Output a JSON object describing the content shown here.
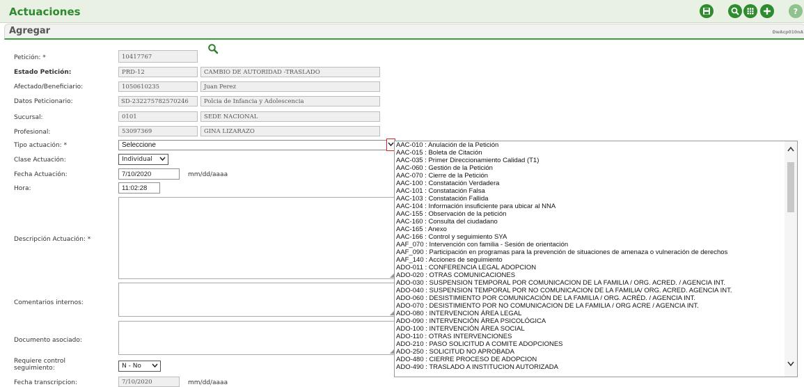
{
  "header": {
    "title": "Actuaciones"
  },
  "toolbar": {
    "icons": [
      "save-icon",
      "search-icon",
      "grid-icon",
      "add-icon",
      "help-icon"
    ]
  },
  "form": {
    "title": "Agregar",
    "program_code": "DwAcp010nA",
    "peticion": {
      "label": "Petición: *",
      "value": "10417767"
    },
    "estado": {
      "label": "Estado Petición:",
      "code": "PRD-12",
      "desc": "CAMBIO DE AUTORIDAD -TRASLADO"
    },
    "afectado": {
      "label": "Afectado/Beneficiario:",
      "code": "1050610235",
      "desc": "Juan Perez"
    },
    "peticionario": {
      "label": "Datos Peticionario:",
      "code": "SD-232275782570246",
      "desc": "Polcia de Infancia y Adolescencia"
    },
    "sucursal": {
      "label": "Sucursal:",
      "code": "0101",
      "desc": "SEDE NACIONAL"
    },
    "profesional": {
      "label": "Profesional:",
      "code": "53097369",
      "desc": "GINA LIZARAZO"
    },
    "tipo": {
      "label": "Tipo actuación: *",
      "value": "Seleccione"
    },
    "clase": {
      "label": "Clase Actuación:",
      "value": "Individual"
    },
    "fecha": {
      "label": "Fecha Actuación:",
      "value": "7/10/2020",
      "hint": "mm/dd/aaaa"
    },
    "hora": {
      "label": "Hora:",
      "value": "11:02:28"
    },
    "descripcion": {
      "label": "Descripción Actuación: *"
    },
    "comentarios": {
      "label": "Comentarios internos:"
    },
    "documento": {
      "label": "Documento asociado:"
    },
    "requiere": {
      "label_line1": "Requiere control",
      "label_line2": "seguimiento:",
      "value": "N - No"
    },
    "transcripcion": {
      "label": "Fecha transcripcion:",
      "value": "7/10/2020",
      "hint": "mm/dd/aaaa"
    }
  },
  "dropdown_options": [
    "AAC-010 : Anulación de la Petición",
    "AAC-015 : Boleta de Citación",
    "AAC-035 : Primer Direccionamiento Calidad (T1)",
    "AAC-060 : Gestión de la Petición",
    "AAC-070 : Cierre de la Petición",
    "AAC-100 : Constatación Verdadera",
    "AAC-101 : Constatación Falsa",
    "AAC-103 : Constatación Fallida",
    "AAC-104 : Información insuficiente para ubicar al NNA",
    "AAC-155 : Observación de la petición",
    "AAC-160 : Consulta del ciudadano",
    "AAC-165 : Anexo",
    "AAC-166 : Control y seguimiento SYA",
    "AAF_070 : Intervención con familia - Sesión de orientación",
    "AAF_090 : Participación en programas para la prevención de situaciones de amenaza o vulneración de derechos",
    "AAF_140 : Acciones de seguimiento",
    "ADO-011 : CONFERENCIA LEGAL ADOPCION",
    "ADO-020 : OTRAS COMUNICACIONES",
    "ADO-030 : SUSPENSION TEMPORAL POR COMUNICACION DE LA FAMILIA / ORG. ACRED. / AGENCIA INT.",
    "ADO-040 : SUSPENSION TEMPORAL POR NO COMUNICACION DE LA FAMILIA/ ORG. ACRED. AGENCIA INT.",
    "ADO-060 : DESISTIMIENTO POR COMUNICACIÓN DE LA FAMILIA / ORG. ACRÉD. / AGENCIA INT.",
    "ADO-070 : DESISTIMIENTO POR NO COMUNICACION DE LA FAMILIA / ORG ACRE / AGENCIA INT.",
    "ADO-080 : INTERVENCION ÁREA LEGAL",
    "ADO-090 : INTERVENCIÓN ÁREA PSICOLÓGICA",
    "ADO-100 : INTERVENCIÓN ÁREA SOCIAL",
    "ADO-110 : OTRAS INTERVENCIONES",
    "ADO-210 : PASO SOLICITUD A COMITE ADOPCIONES",
    "ADO-250 : SOLICITUD NO APROBADA",
    "ADO-480 : CIERRE PROCESO DE ADOPCION",
    "ADO-490 : TRASLADO A INSTITUCION AUTORIZADA"
  ],
  "colors": {
    "accent": "#2d8a2d",
    "highlight": "#d22222"
  }
}
